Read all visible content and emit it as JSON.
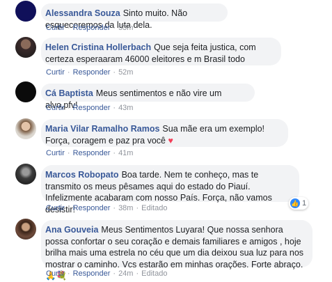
{
  "action_labels": {
    "like": "Curtir",
    "reply": "Responder",
    "edited": "Editado",
    "separator": "·"
  },
  "comments": [
    {
      "author": "Alessandra Souza",
      "text": "Sinto muito. Não esqueceremos da luta dela.",
      "time": "53m"
    },
    {
      "author": "Helen Cristina Hollerbach",
      "text": "Que seja feita justica, com certeza esperaaram 46000 eleitores e m Brasil todo",
      "time": "52m"
    },
    {
      "author": "Cá Baptista",
      "text": "Meus sentimentos e não vire um alvo,pfv!",
      "time": "43m"
    },
    {
      "author": "Maria Vilar Ramalho Ramos",
      "text": "Sua mãe era um exemplo! Força, coragem e paz pra você",
      "emoji": "♥",
      "time": "41m"
    },
    {
      "author": "Marcos Robopato",
      "text": "Boa tarde. Nem te conheço, mas te transmito os meus pêsames aqui do estado do Piauí. Infelizmente acabaram com nosso País. Força, não vamos desistir!",
      "time": "38m",
      "reaction_count": "1"
    },
    {
      "author": "Ana Gouveia",
      "text": "Meus Sentimentos Luyara! Que nossa senhora possa confortar o seu coração e demais familiares e amigos , hoje brilha mais uma estrela no céu que um dia deixou sua luz para nos mostrar o caminho. Vcs estarão em minhas orações. Forte abraço.",
      "emoji": "🙏💐",
      "time": "24m"
    }
  ]
}
